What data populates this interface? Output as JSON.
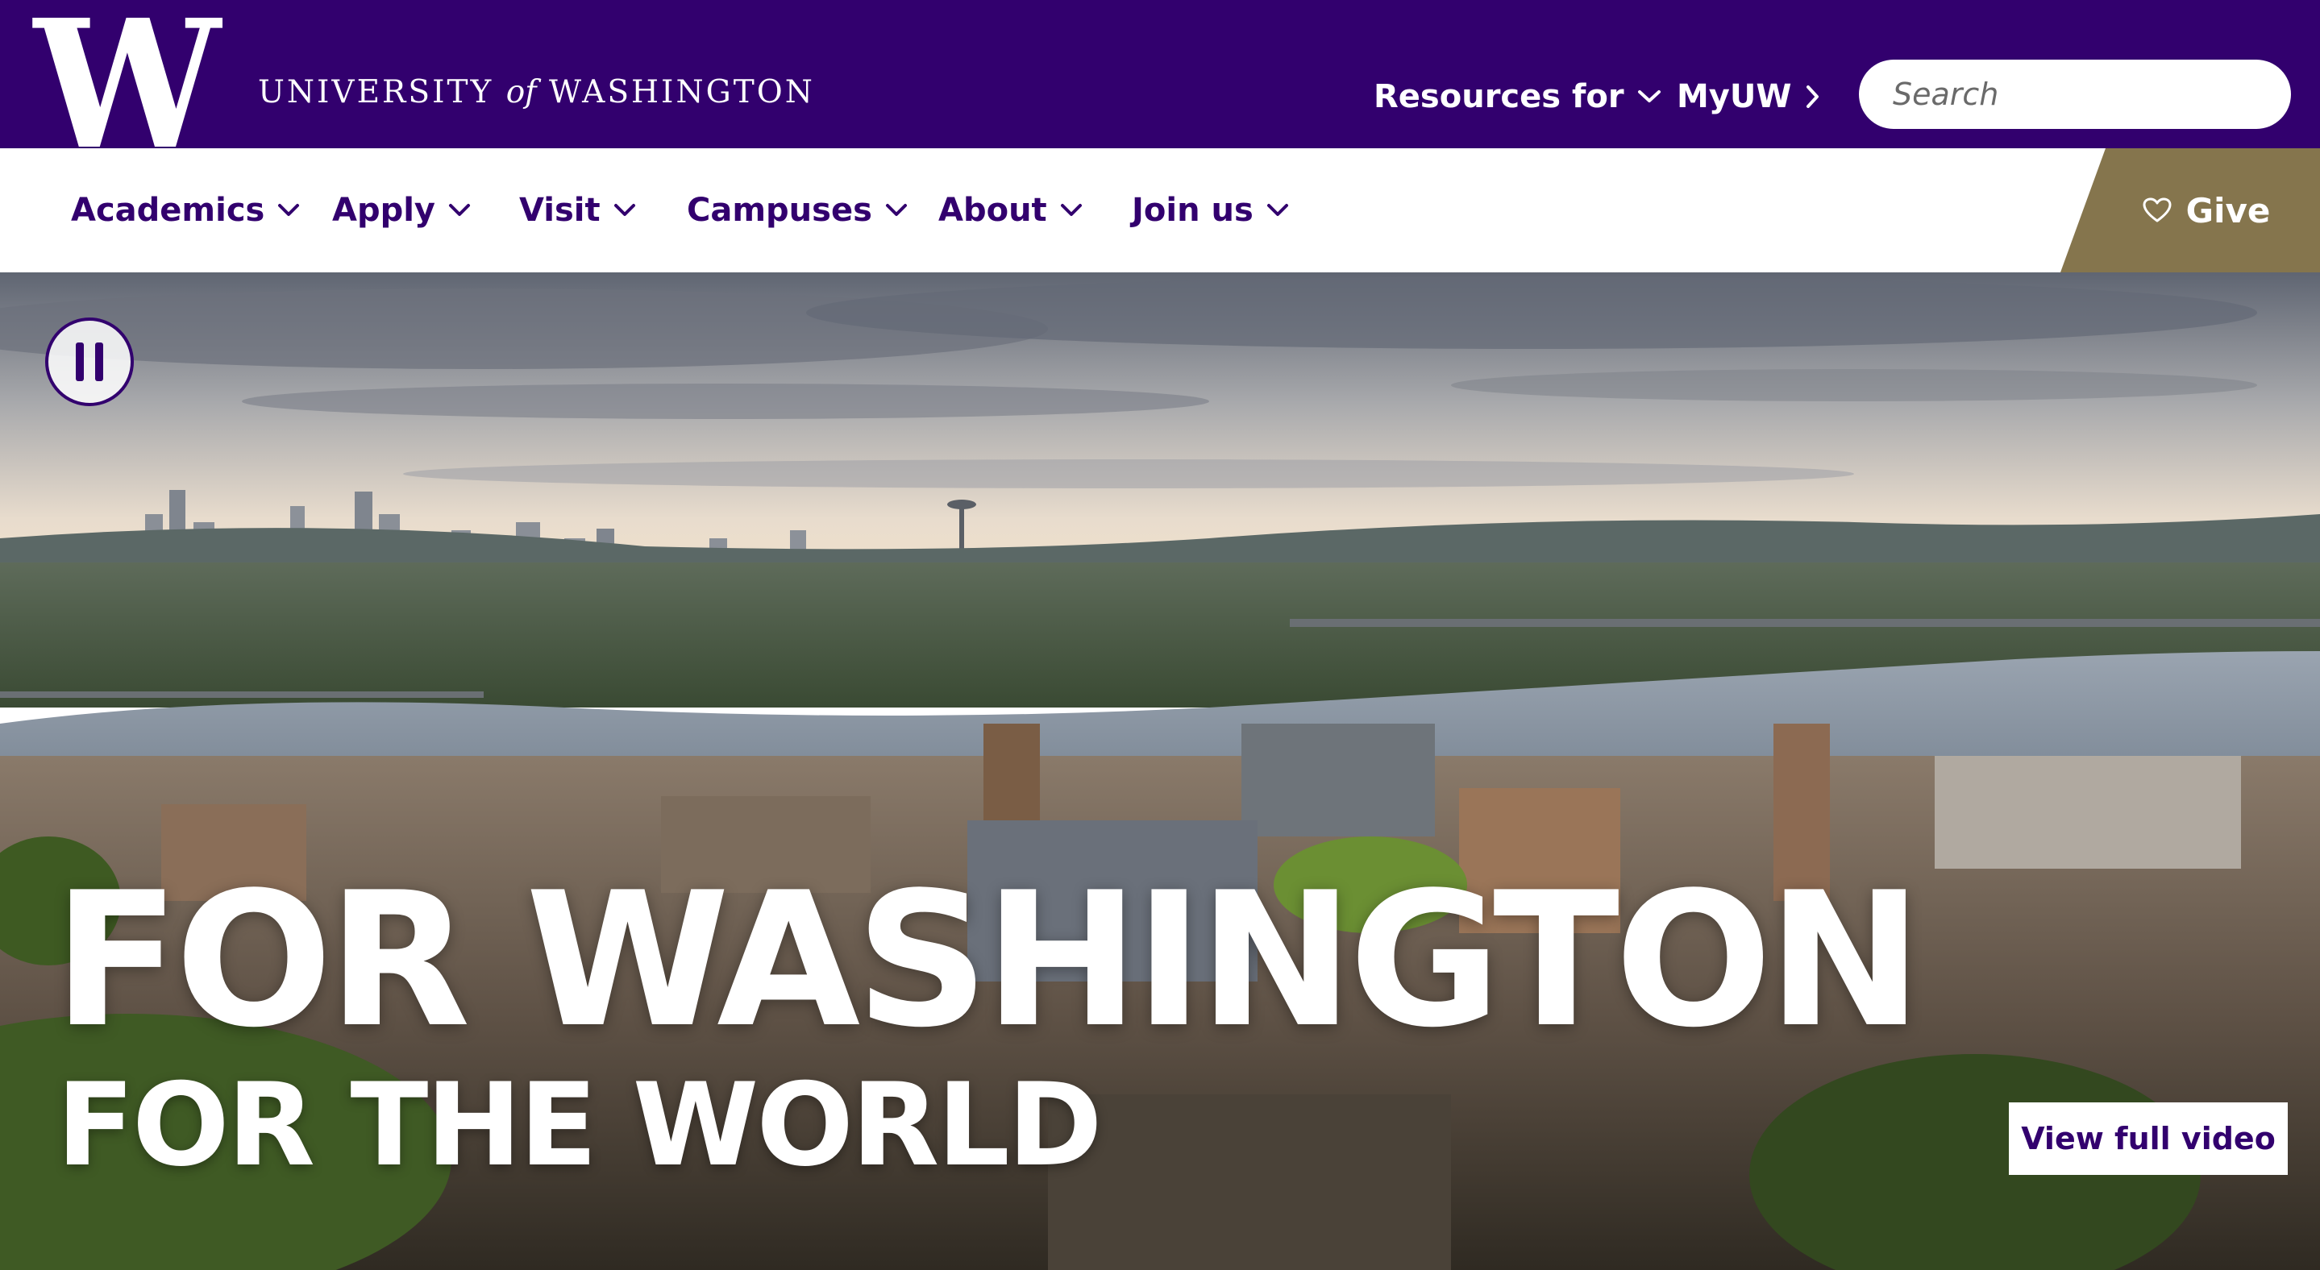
{
  "header": {
    "logo_letter": "W",
    "wordmark": {
      "part1": "UNIVERSITY",
      "part2": "of",
      "part3": "WASHINGTON"
    },
    "resources_label": "Resources for",
    "myuw_label": "MyUW",
    "search": {
      "placeholder": "Search",
      "value": ""
    }
  },
  "nav": {
    "items": [
      {
        "label": "Academics"
      },
      {
        "label": "Apply"
      },
      {
        "label": "Visit"
      },
      {
        "label": "Campuses"
      },
      {
        "label": "About"
      },
      {
        "label": "Join us"
      }
    ],
    "give_label": "Give"
  },
  "hero": {
    "title": "FOR WASHINGTON",
    "subtitle": "FOR THE WORLD",
    "video_button_label": "View full video"
  },
  "icons": {
    "resources": "chevron-down-icon",
    "myuw": "chevron-right-icon",
    "search": "search-icon",
    "give": "heart-icon",
    "pause": "pause-icon"
  },
  "colors": {
    "purple": "#32006e",
    "gold": "#85754d",
    "white": "#ffffff"
  }
}
